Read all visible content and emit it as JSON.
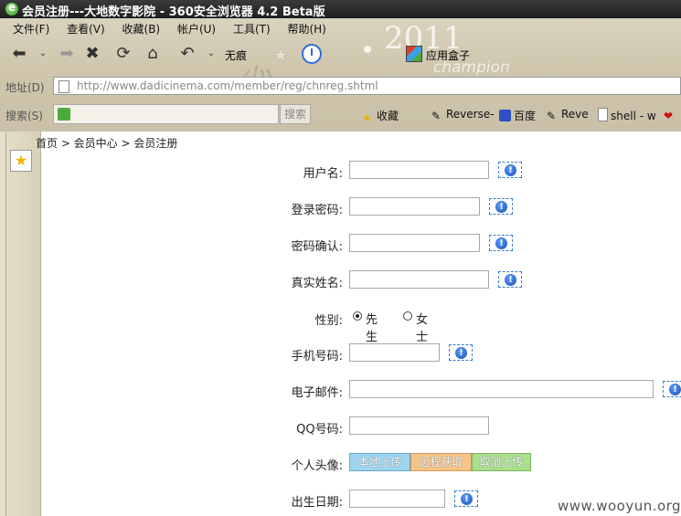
{
  "window": {
    "title": "会员注册---大地数字影院 - 360安全浏览器 4.2 Beta版"
  },
  "menu": [
    "文件(F)",
    "查看(V)",
    "收藏(B)",
    "帐户(U)",
    "工具(T)",
    "帮助(H)"
  ],
  "navbar": {
    "wuhen": "无痕",
    "appbox": "应用盒子"
  },
  "address": {
    "label": "地址(D)",
    "url": "http://www.dadicinema.com/member/reg/chnreg.shtml"
  },
  "search": {
    "label": "搜索(S)",
    "button": "搜索"
  },
  "favorites": [
    "收藏",
    "Reverse-",
    "百度",
    "Reve",
    "shell - w"
  ],
  "banner": {
    "year": "2011",
    "word": "champion"
  },
  "breadcrumb": "首页 > 会员中心 > 会员注册",
  "form": {
    "username": "用户名:",
    "password": "登录密码:",
    "confirm": "密码确认:",
    "realname": "真实姓名:",
    "gender": "性别:",
    "male": "先生",
    "female": "女士",
    "mobile": "手机号码:",
    "email": "电子邮件:",
    "qq": "QQ号码:",
    "avatar": "个人头像:",
    "upload_local": "本地上传",
    "upload_remote": "远程获取",
    "upload_cancel": "取消上传",
    "birthday": "出生日期:",
    "gender_selected": "先生"
  },
  "watermark": "www.wooyun.org"
}
